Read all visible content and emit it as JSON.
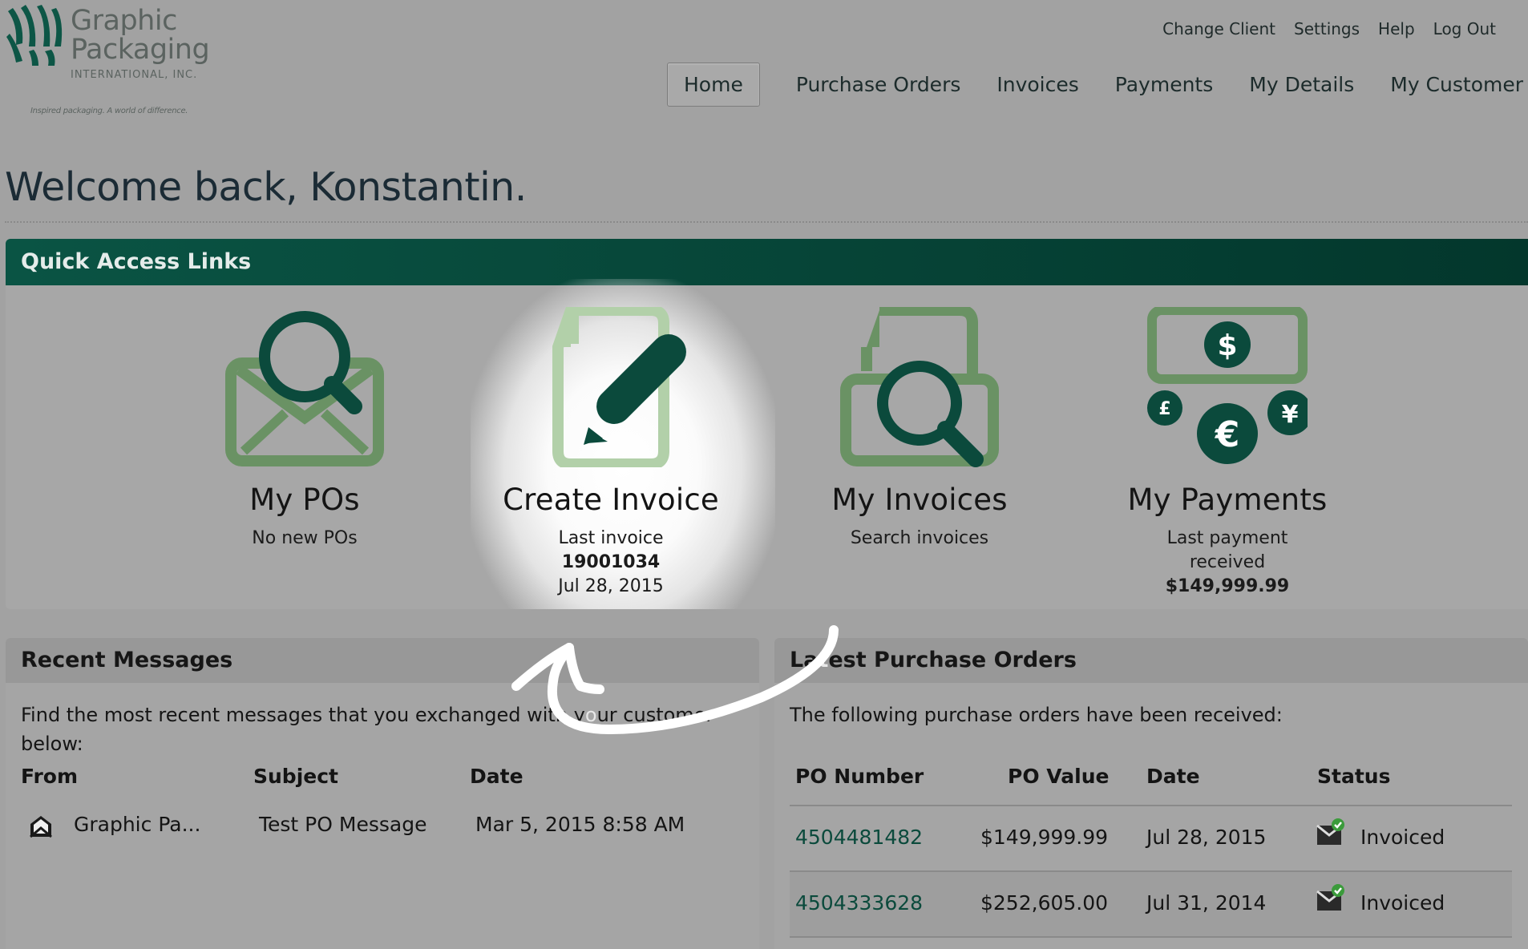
{
  "brand": {
    "name_line1": "Graphic",
    "name_line2": "Packaging",
    "sub": "INTERNATIONAL, INC.",
    "tagline": "Inspired packaging. A world of difference.",
    "color": "#0a5444"
  },
  "top_links": [
    "Change Client",
    "Settings",
    "Help",
    "Log Out"
  ],
  "nav": {
    "items": [
      "Home",
      "Purchase Orders",
      "Invoices",
      "Payments",
      "My Details",
      "My Customer"
    ],
    "active": "Home"
  },
  "welcome": "Welcome back, Konstantin.",
  "quick_access": {
    "title": "Quick Access Links",
    "tiles": [
      {
        "icon": "envelope-search-icon",
        "title": "My POs",
        "line1": "No new POs",
        "line2": "",
        "line3": ""
      },
      {
        "icon": "document-pencil-icon",
        "title": "Create Invoice",
        "line1": "Last invoice",
        "line2": "19001034",
        "line3": "Jul 28, 2015"
      },
      {
        "icon": "document-search-icon",
        "title": "My Invoices",
        "line1": "Search invoices",
        "line2": "",
        "line3": ""
      },
      {
        "icon": "currency-icon",
        "title": "My Payments",
        "line1": "Last payment",
        "line1b": "received",
        "line2": "$149,999.99"
      }
    ]
  },
  "messages": {
    "title": "Recent Messages",
    "intro_a": "Find the most recent messages that you exchanged with y",
    "intro_b": "ur customer",
    "intro_c": "below:",
    "columns": [
      "From",
      "Subject",
      "Date"
    ],
    "rows": [
      {
        "from": "Graphic Pa...",
        "subject": "Test PO Message",
        "date": "Mar 5, 2015 8:58 AM"
      }
    ]
  },
  "purchase_orders": {
    "title_a": "La",
    "title_b": "est Purchase Orders",
    "intro": "The following purchase orders have been received:",
    "columns": [
      "PO Number",
      "PO Value",
      "Date",
      "Status"
    ],
    "rows": [
      {
        "number": "4504481482",
        "value": "$149,999.99",
        "date": "Jul 28, 2015",
        "status": "Invoiced"
      },
      {
        "number": "4504333628",
        "value": "$252,605.00",
        "date": "Jul 31, 2014",
        "status": "Invoiced"
      }
    ]
  }
}
